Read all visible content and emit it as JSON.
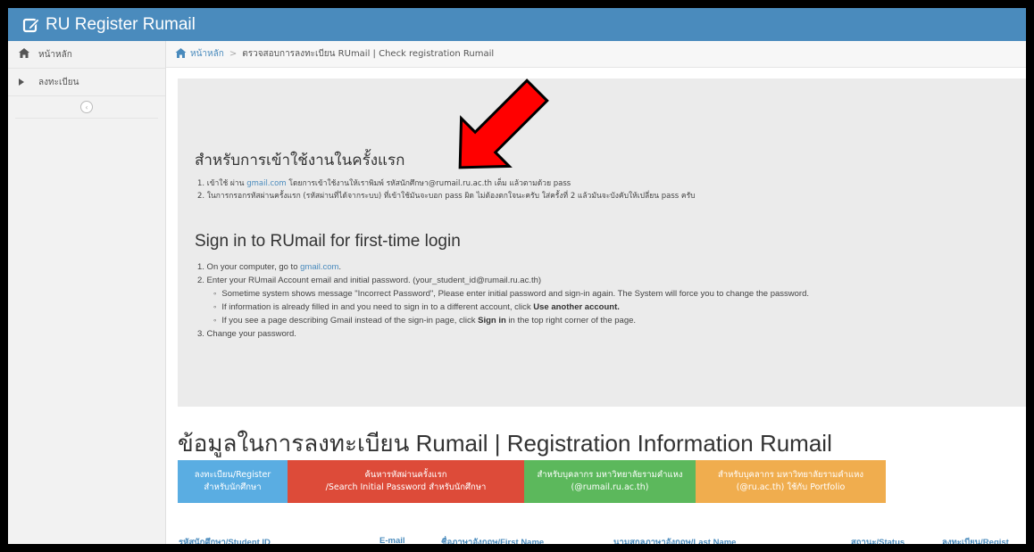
{
  "app": {
    "title": "RU Register Rumail",
    "brand_icon": "edit-icon"
  },
  "sidebar": {
    "items": [
      {
        "label": "หน้าหลัก",
        "icon": "home-icon"
      },
      {
        "label": "ลงทะเบียน",
        "icon": "caret-right-icon"
      }
    ],
    "collapse_icon": "chevron-left-icon"
  },
  "breadcrumb": {
    "home": "หน้าหลัก",
    "separator": ">",
    "current": "ตรวจสอบการลงทะเบียน RUmail | Check registration Rumail"
  },
  "info": {
    "thai_heading": "สำหรับการเข้าใช้งานในครั้งแรก",
    "thai_steps": [
      {
        "pre": "1. เข้าใช้ ผ่าน ",
        "link": "gmail.com",
        "post": " โดยการเข้าใช้งานให้เราพิมพ์ รหัสนักศึกษา@rumail.ru.ac.th เต็ม แล้วตามด้วย pass"
      },
      {
        "pre": "2. ในการกรอกรหัสผ่านครั้งแรก (รหัสผ่านที่ได้จากระบบ) ที่เข้าใช้มันจะบอก pass ผิด ไม่ต้องตกใจนะครับ ใส่ครั้งที่ 2 แล้วมันจะบังคับให้เปลี่ยน pass ครับ",
        "link": "",
        "post": ""
      }
    ],
    "en_heading": "Sign in to RUmail for first-time login",
    "en_step1_pre": "1. On your computer, go to ",
    "en_step1_link": "gmail.com",
    "en_step1_post": ".",
    "en_step2": "2. Enter your RUmail Account email and initial password. (your_student_id@rumail.ru.ac.th)",
    "en_sub1": "Sometime system shows message \"Incorrect Password\", Please enter initial password and sign-in again. The System will force you to change the password.",
    "en_sub2_pre": "If information is already filled in and you need to sign in to a different account, click ",
    "en_sub2_bold": "Use another account.",
    "en_sub3_pre": "If you see a page describing Gmail instead of the sign-in page, click ",
    "en_sub3_bold": "Sign in",
    "en_sub3_post": " in the top right corner of the page.",
    "en_step3": "3. Change your password."
  },
  "registration": {
    "title": "ข้อมูลในการลงทะเบียน Rumail | Registration Information Rumail",
    "buttons": [
      {
        "line1": "ลงทะเบียน/Register",
        "line2": "สำหรับนักศึกษา"
      },
      {
        "line1": "ค้นหารหัสผ่านครั้งแรก",
        "line2": "/Search Initial Password สำหรับนักศึกษา"
      },
      {
        "line1": "สำหรับบุคลากร มหาวิทยาลัยรามคำแหง",
        "line2": "(@rumail.ru.ac.th)"
      },
      {
        "line1": "สำหรับบุคลากร มหาวิทยาลัยรามคำแหง",
        "line2": "(@ru.ac.th) ใช้กับ Portfolio"
      }
    ],
    "columns": [
      "รหัสนักศึกษา/Student ID",
      "E-mail",
      "ชื่อภาษาอังกฤษ/First Name",
      "นามสกุลภาษาอังกฤษ/Last Name",
      "สถานะ/Status",
      "ลงทะเบียน/Regist"
    ]
  },
  "colors": {
    "topbar": "#4a8bbd",
    "blue": "#5aade2",
    "red": "#dd4b39",
    "green": "#5cb85c",
    "orange": "#f0ad4e",
    "arrow": "#ff0000"
  }
}
